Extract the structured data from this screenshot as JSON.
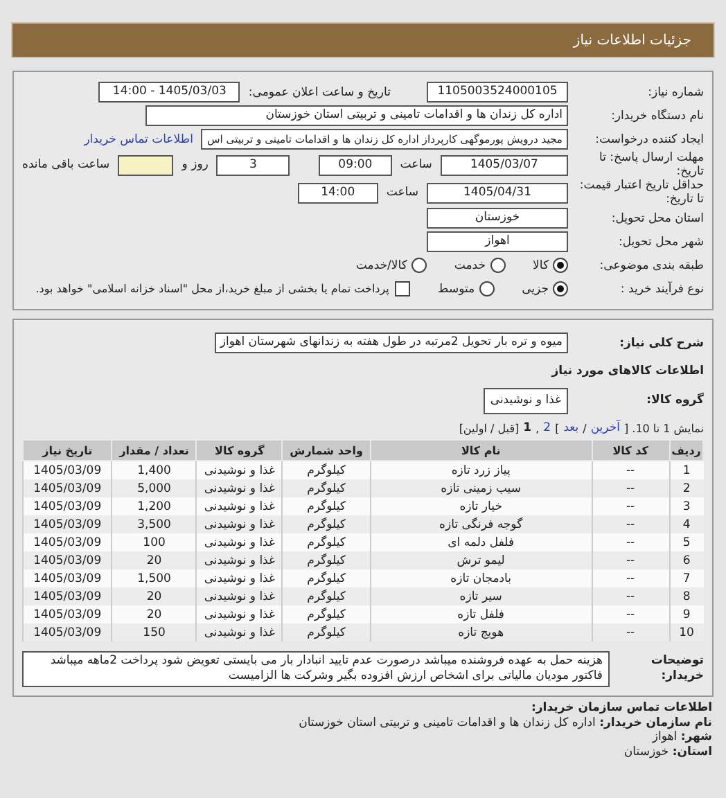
{
  "header": {
    "title": "جزئیات اطلاعات نیاز"
  },
  "need": {
    "need_number": {
      "label": "شماره نیاز:",
      "value": "1105003524000105"
    },
    "announce": {
      "label": "تاریخ و ساعت اعلان عمومی:",
      "value": "1405/03/03 - 14:00"
    },
    "buyer_org": {
      "label": "نام دستگاه خریدار:",
      "value": "اداره کل زندان ها و اقدامات تامینی و تربیتی استان خوزستان"
    },
    "requester": {
      "label": "ایجاد کننده درخواست:",
      "value": "مجید درویش پورموگهی کارپرداز اداره کل زندان ها و اقدامات تامینی و تربیتی اس",
      "link": "اطلاعات تماس خریدار"
    },
    "deadline": {
      "label": "مهلت ارسال پاسخ: تا تاریخ:",
      "date": "1405/03/07",
      "time_label": "ساعت",
      "time": "09:00",
      "days": "3",
      "days_label": "روز و",
      "remaining_label": "ساعت باقی مانده"
    },
    "validity": {
      "label": "حداقل تاریخ اعتبار قیمت: تا تاریخ:",
      "date": "1405/04/31",
      "time_label": "ساعت",
      "time": "14:00"
    },
    "province": {
      "label": "استان محل تحویل:",
      "value": "خوزستان"
    },
    "city": {
      "label": "شهر محل تحویل:",
      "value": "اهواز"
    },
    "category": {
      "label": "طبقه بندی موضوعی:",
      "options": [
        {
          "label": "کالا",
          "selected": true
        },
        {
          "label": "خدمت",
          "selected": false
        },
        {
          "label": "کالا/خدمت",
          "selected": false
        }
      ]
    },
    "process": {
      "label": "نوع فرآیند خرید :",
      "options": [
        {
          "label": "جزیی",
          "selected": true
        },
        {
          "label": "متوسط",
          "selected": false
        }
      ],
      "treasury": {
        "label": "پرداخت تمام یا بخشی از مبلغ خرید،از محل \"اسناد خزانه اسلامی\" خواهد بود.",
        "checked": false
      }
    }
  },
  "goods": {
    "description": {
      "label": "شرح کلی نیاز:",
      "value": "میوه و تره بار تحویل 2مرتبه در طول هفته به زندانهای شهرستان اهواز"
    },
    "section_title": "اطلاعات کالاهای مورد نیاز",
    "group": {
      "label": "گروه کالا:",
      "value": "غذا و نوشیدنی"
    },
    "pagination": [
      {
        "kind": "text",
        "text": "نمایش 1 تا 10. ["
      },
      {
        "kind": "link",
        "text": "آخرین"
      },
      {
        "kind": "text",
        "text": "/"
      },
      {
        "kind": "link",
        "text": "بعد"
      },
      {
        "kind": "text",
        "text": "]"
      },
      {
        "kind": "link",
        "text": "2"
      },
      {
        "kind": "text",
        "text": ","
      },
      {
        "kind": "current",
        "text": "1"
      },
      {
        "kind": "text",
        "text": "[قبل / اولین]"
      }
    ],
    "table": {
      "columns": [
        "ردیف",
        "کد کالا",
        "نام کالا",
        "واحد شمارش",
        "گروه کالا",
        "تعداد / مقدار",
        "تاریخ نیاز"
      ],
      "rows": [
        [
          "1",
          "--",
          "پیاز زرد تازه",
          "کیلوگرم",
          "غذا و نوشیدنی",
          "1,400",
          "1405/03/09"
        ],
        [
          "2",
          "--",
          "سیب زمینی تازه",
          "کیلوگرم",
          "غذا و نوشیدنی",
          "5,000",
          "1405/03/09"
        ],
        [
          "3",
          "--",
          "خیار تازه",
          "کیلوگرم",
          "غذا و نوشیدنی",
          "1,200",
          "1405/03/09"
        ],
        [
          "4",
          "--",
          "گوجه فرنگی تازه",
          "کیلوگرم",
          "غذا و نوشیدنی",
          "3,500",
          "1405/03/09"
        ],
        [
          "5",
          "--",
          "فلفل دلمه ای",
          "کیلوگرم",
          "غذا و نوشیدنی",
          "100",
          "1405/03/09"
        ],
        [
          "6",
          "--",
          "لیمو ترش",
          "کیلوگرم",
          "غذا و نوشیدنی",
          "20",
          "1405/03/09"
        ],
        [
          "7",
          "--",
          "بادمجان تازه",
          "کیلوگرم",
          "غذا و نوشیدنی",
          "1,500",
          "1405/03/09"
        ],
        [
          "8",
          "--",
          "سیر تازه",
          "کیلوگرم",
          "غذا و نوشیدنی",
          "20",
          "1405/03/09"
        ],
        [
          "9",
          "--",
          "فلفل تازه",
          "کیلوگرم",
          "غذا و نوشیدنی",
          "20",
          "1405/03/09"
        ],
        [
          "10",
          "--",
          "هویج تازه",
          "کیلوگرم",
          "غذا و نوشیدنی",
          "150",
          "1405/03/09"
        ]
      ]
    },
    "buyer_notes": {
      "label": "توضیحات خریدار:",
      "value": "هزینه حمل به عهده فروشنده میباشد درصورت عدم تایید انبادار بار می بایستی تعویض شود پرداخت 2ماهه میباشد فاکتور مودیان مالیاتی برای اشخاص ارزش افزوده بگیر وشرکت ها الزامیست"
    }
  },
  "contact": {
    "title": "اطلاعات تماس سازمان خریدار:",
    "lines": [
      {
        "label": "نام سازمان خریدار:",
        "value": "اداره کل زندان ها و اقدامات تامینی و تربیتی استان خوزستان"
      },
      {
        "label": "شهر:",
        "value": "اهواز"
      },
      {
        "label": "استان:",
        "value": "خوزستان"
      }
    ]
  }
}
